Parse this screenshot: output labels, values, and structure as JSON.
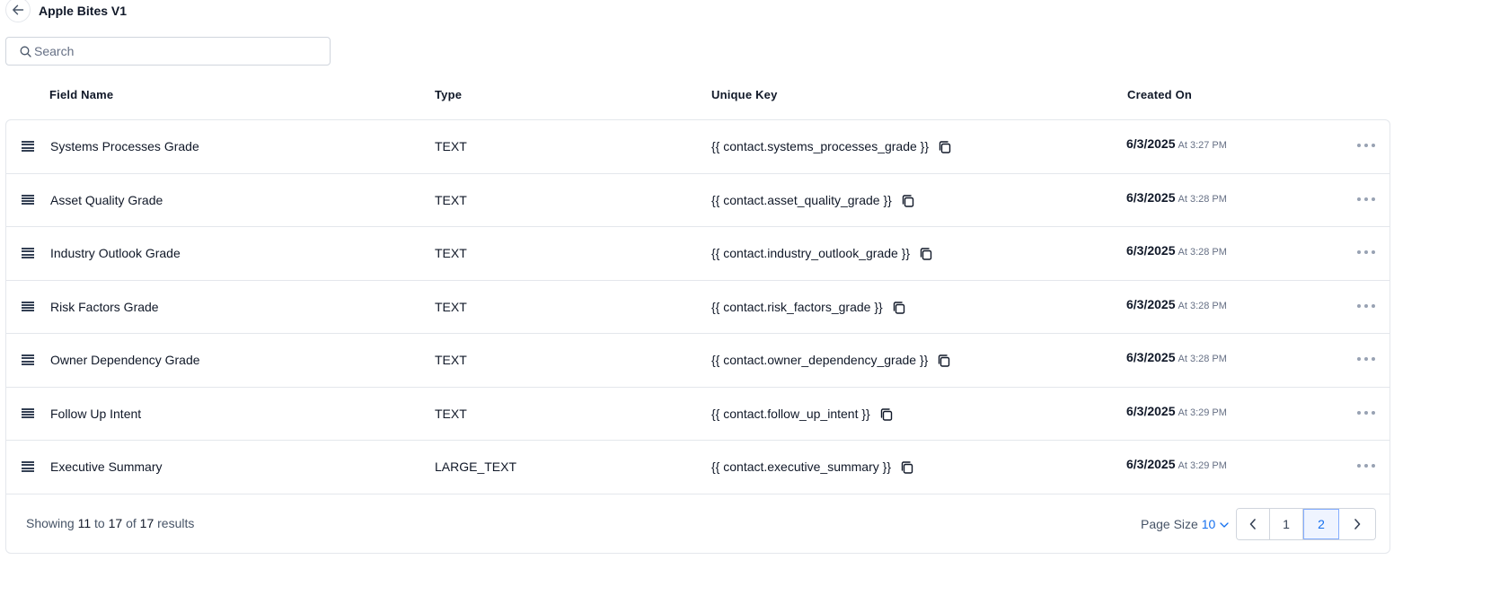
{
  "header": {
    "back_icon": "arrow-left-icon",
    "title": "Apple Bites V1"
  },
  "search": {
    "placeholder": "Search",
    "value": "",
    "icon": "search-icon"
  },
  "columns": {
    "field_name": "Field Name",
    "type": "Type",
    "unique_key": "Unique Key",
    "created_on": "Created On"
  },
  "rows": [
    {
      "name": "Systems Processes Grade",
      "type": "TEXT",
      "key": "{{ contact.systems_processes_grade }}",
      "date": "6/3/2025",
      "time": "At 3:27 PM"
    },
    {
      "name": "Asset Quality Grade",
      "type": "TEXT",
      "key": "{{ contact.asset_quality_grade }}",
      "date": "6/3/2025",
      "time": "At 3:28 PM"
    },
    {
      "name": "Industry Outlook Grade",
      "type": "TEXT",
      "key": "{{ contact.industry_outlook_grade }}",
      "date": "6/3/2025",
      "time": "At 3:28 PM"
    },
    {
      "name": "Risk Factors Grade",
      "type": "TEXT",
      "key": "{{ contact.risk_factors_grade }}",
      "date": "6/3/2025",
      "time": "At 3:28 PM"
    },
    {
      "name": "Owner Dependency Grade",
      "type": "TEXT",
      "key": "{{ contact.owner_dependency_grade }}",
      "date": "6/3/2025",
      "time": "At 3:28 PM"
    },
    {
      "name": "Follow Up Intent",
      "type": "TEXT",
      "key": "{{ contact.follow_up_intent }}",
      "date": "6/3/2025",
      "time": "At 3:29 PM"
    },
    {
      "name": "Executive Summary",
      "type": "LARGE_TEXT",
      "key": "{{ contact.executive_summary }}",
      "date": "6/3/2025",
      "time": "At 3:29 PM"
    }
  ],
  "footer": {
    "showing_prefix": "Showing",
    "from": "11",
    "to_word": "to",
    "to": "17",
    "of_word": "of",
    "total": "17",
    "results_word": "results",
    "page_size_label": "Page Size",
    "page_size_value": "10",
    "pages": [
      "1",
      "2"
    ],
    "current_page": "2"
  },
  "colors": {
    "accent": "#1570ef",
    "border": "#e4e7ec",
    "text": "#101828",
    "muted": "#667085"
  }
}
